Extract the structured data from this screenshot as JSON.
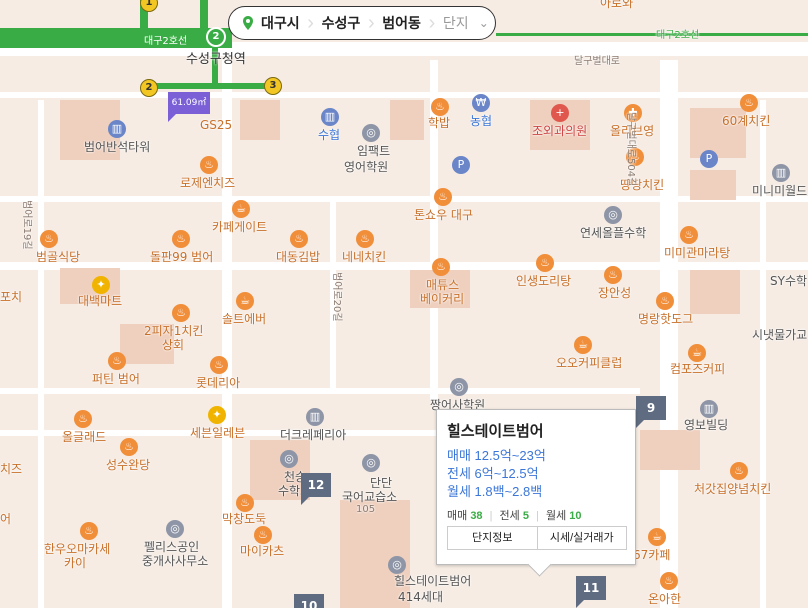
{
  "breadcrumb": {
    "items": [
      "대구시",
      "수성구",
      "범어동"
    ],
    "last": "단지",
    "pin_color": "#3aac45"
  },
  "popup": {
    "title": "힐스테이트범어",
    "sale": "매매 12.5억~23억",
    "jeonse": "전세 6억~12.5억",
    "monthly": "월세 1.8백~2.8백",
    "counts": {
      "sale_label": "매매",
      "sale_n": "38",
      "jeonse_label": "전세",
      "jeonse_n": "5",
      "monthly_label": "월세",
      "monthly_n": "10"
    },
    "btn_info": "단지정보",
    "btn_price": "시세/실거래가"
  },
  "pyeong_badge": "61.09㎡",
  "markers": [
    "9",
    "12",
    "11",
    "10"
  ],
  "subway": {
    "line_label_left": "대구2호선",
    "line_label_right": "대구2호선",
    "station": "수성구청역",
    "exits": [
      "1",
      "2",
      "2",
      "3",
      "3"
    ]
  },
  "labels": {
    "gs25": "GS25",
    "beomeo_tower": "범어반석타워",
    "suhyup": "수협",
    "impact": "임팩트",
    "english": "영어학원",
    "hakbap": "학밥",
    "nonghyup": "농협",
    "jowoe": "조외과의원",
    "olive": "올리브영",
    "chicken60": "60계치킨",
    "rose": "로제엔치즈",
    "ttangttang": "땅땅치킨",
    "minimal": "미니미월드",
    "cafegate": "카페게이트",
    "tonshow": "톤쇼우 대구",
    "yeonse": "연세올플수학",
    "beomgol": "범골식당",
    "dolpan": "돌판99 범어",
    "daedong": "대동김밥",
    "nene": "네네치킨",
    "mimi": "미미관마라탕",
    "sy": "SY수학",
    "daebaek": "대백마트",
    "matyus": "매튜스",
    "bakery": "베이커리",
    "insaeng": "인생도리탕",
    "jangin": "장안성",
    "myeongrang": "명랑핫도그",
    "sinaegul": "시냇물가교",
    "pizza": "2피자1치킨",
    "sanghoe": "상회",
    "solteu": "솔트에버",
    "ohoh": "오오커피클럽",
    "compose": "컴포즈커피",
    "furt": "퍼틴 범어",
    "lotteria": "롯데리아",
    "jjangeo": "짱어사학원",
    "yeongbo": "영보빌딩",
    "seven": "세븐일레븐",
    "olgrand": "올글래드",
    "theclass": "더크레페리아",
    "seongsu": "성수완당",
    "cheonsu": "천승",
    "suhak": "수학교",
    "dandan": "단단",
    "gukeo": "국어교습소",
    "n105": "105",
    "cheotgat": "처갓집양념치킨",
    "makchang": "막창도둑",
    "maika": "마이카츠",
    "hanwoo": "한우오마카세",
    "kai": "카이",
    "pelis": "펠리스공인",
    "junggae": "중개사사무소",
    "hills": "힐스테이트범어",
    "hills_units": "414세대",
    "su67": "수67카페",
    "onahan": "온아한",
    "dalgubeol": "달구벌대로",
    "dalgu504": "달구벌대로504길",
    "beomeo20": "범어로20길",
    "beomeo19": "범어로19길",
    "pochi": "포치",
    "cheese": "치즈",
    "eo": "어",
    "aroa": "아로와"
  }
}
